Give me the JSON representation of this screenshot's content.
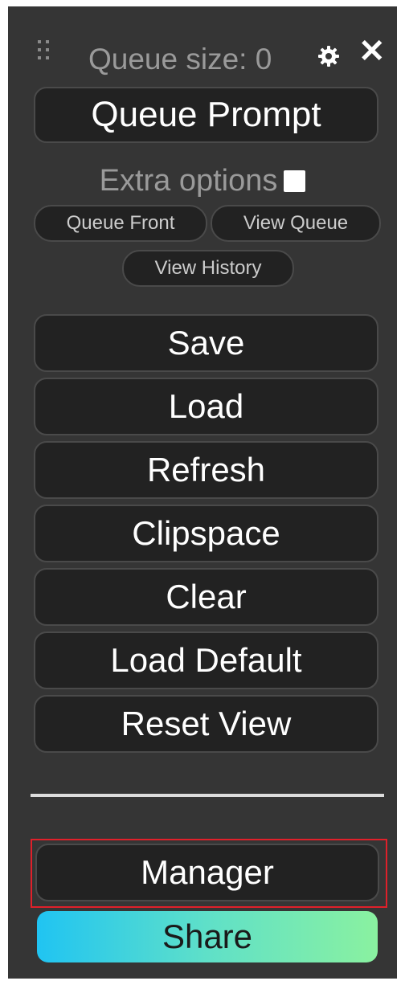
{
  "header": {
    "queue_size": "Queue size: 0",
    "settings_icon": "gear-icon",
    "close_icon": "close-icon",
    "close_glyph": "✕"
  },
  "queue_prompt_label": "Queue Prompt",
  "extra_options": {
    "label": "Extra options",
    "checked": false
  },
  "small_buttons": {
    "queue_front": "Queue Front",
    "view_queue": "View Queue",
    "view_history": "View History"
  },
  "menu": {
    "save": "Save",
    "load": "Load",
    "refresh": "Refresh",
    "clipspace": "Clipspace",
    "clear": "Clear",
    "load_default": "Load Default",
    "reset_view": "Reset View"
  },
  "manager_label": "Manager",
  "share_label": "Share",
  "colors": {
    "panel_bg": "#353535",
    "button_bg": "#222222",
    "highlight": "#e0202a",
    "share_gradient_start": "#20c4f2",
    "share_gradient_end": "#8af1a0"
  }
}
